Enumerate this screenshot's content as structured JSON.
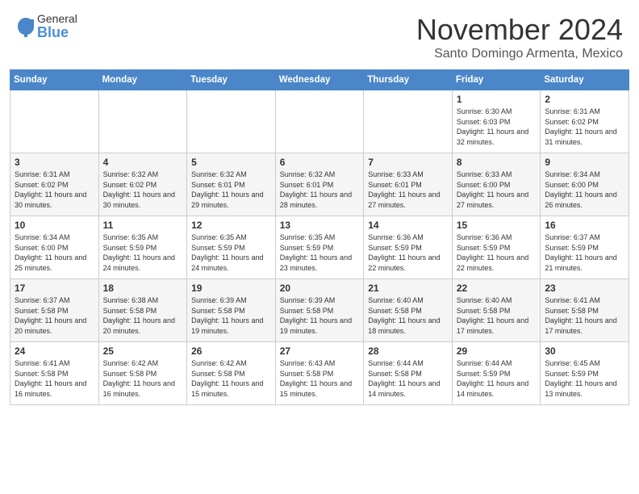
{
  "logo": {
    "general": "General",
    "blue": "Blue"
  },
  "title": {
    "month": "November 2024",
    "location": "Santo Domingo Armenta, Mexico"
  },
  "days_of_week": [
    "Sunday",
    "Monday",
    "Tuesday",
    "Wednesday",
    "Thursday",
    "Friday",
    "Saturday"
  ],
  "weeks": [
    [
      {
        "day": "",
        "info": ""
      },
      {
        "day": "",
        "info": ""
      },
      {
        "day": "",
        "info": ""
      },
      {
        "day": "",
        "info": ""
      },
      {
        "day": "",
        "info": ""
      },
      {
        "day": "1",
        "info": "Sunrise: 6:30 AM\nSunset: 6:03 PM\nDaylight: 11 hours\nand 32 minutes."
      },
      {
        "day": "2",
        "info": "Sunrise: 6:31 AM\nSunset: 6:02 PM\nDaylight: 11 hours\nand 31 minutes."
      }
    ],
    [
      {
        "day": "3",
        "info": "Sunrise: 6:31 AM\nSunset: 6:02 PM\nDaylight: 11 hours\nand 30 minutes."
      },
      {
        "day": "4",
        "info": "Sunrise: 6:32 AM\nSunset: 6:02 PM\nDaylight: 11 hours\nand 30 minutes."
      },
      {
        "day": "5",
        "info": "Sunrise: 6:32 AM\nSunset: 6:01 PM\nDaylight: 11 hours\nand 29 minutes."
      },
      {
        "day": "6",
        "info": "Sunrise: 6:32 AM\nSunset: 6:01 PM\nDaylight: 11 hours\nand 28 minutes."
      },
      {
        "day": "7",
        "info": "Sunrise: 6:33 AM\nSunset: 6:01 PM\nDaylight: 11 hours\nand 27 minutes."
      },
      {
        "day": "8",
        "info": "Sunrise: 6:33 AM\nSunset: 6:00 PM\nDaylight: 11 hours\nand 27 minutes."
      },
      {
        "day": "9",
        "info": "Sunrise: 6:34 AM\nSunset: 6:00 PM\nDaylight: 11 hours\nand 26 minutes."
      }
    ],
    [
      {
        "day": "10",
        "info": "Sunrise: 6:34 AM\nSunset: 6:00 PM\nDaylight: 11 hours\nand 25 minutes."
      },
      {
        "day": "11",
        "info": "Sunrise: 6:35 AM\nSunset: 5:59 PM\nDaylight: 11 hours\nand 24 minutes."
      },
      {
        "day": "12",
        "info": "Sunrise: 6:35 AM\nSunset: 5:59 PM\nDaylight: 11 hours\nand 24 minutes."
      },
      {
        "day": "13",
        "info": "Sunrise: 6:35 AM\nSunset: 5:59 PM\nDaylight: 11 hours\nand 23 minutes."
      },
      {
        "day": "14",
        "info": "Sunrise: 6:36 AM\nSunset: 5:59 PM\nDaylight: 11 hours\nand 22 minutes."
      },
      {
        "day": "15",
        "info": "Sunrise: 6:36 AM\nSunset: 5:59 PM\nDaylight: 11 hours\nand 22 minutes."
      },
      {
        "day": "16",
        "info": "Sunrise: 6:37 AM\nSunset: 5:59 PM\nDaylight: 11 hours\nand 21 minutes."
      }
    ],
    [
      {
        "day": "17",
        "info": "Sunrise: 6:37 AM\nSunset: 5:58 PM\nDaylight: 11 hours\nand 20 minutes."
      },
      {
        "day": "18",
        "info": "Sunrise: 6:38 AM\nSunset: 5:58 PM\nDaylight: 11 hours\nand 20 minutes."
      },
      {
        "day": "19",
        "info": "Sunrise: 6:39 AM\nSunset: 5:58 PM\nDaylight: 11 hours\nand 19 minutes."
      },
      {
        "day": "20",
        "info": "Sunrise: 6:39 AM\nSunset: 5:58 PM\nDaylight: 11 hours\nand 19 minutes."
      },
      {
        "day": "21",
        "info": "Sunrise: 6:40 AM\nSunset: 5:58 PM\nDaylight: 11 hours\nand 18 minutes."
      },
      {
        "day": "22",
        "info": "Sunrise: 6:40 AM\nSunset: 5:58 PM\nDaylight: 11 hours\nand 17 minutes."
      },
      {
        "day": "23",
        "info": "Sunrise: 6:41 AM\nSunset: 5:58 PM\nDaylight: 11 hours\nand 17 minutes."
      }
    ],
    [
      {
        "day": "24",
        "info": "Sunrise: 6:41 AM\nSunset: 5:58 PM\nDaylight: 11 hours\nand 16 minutes."
      },
      {
        "day": "25",
        "info": "Sunrise: 6:42 AM\nSunset: 5:58 PM\nDaylight: 11 hours\nand 16 minutes."
      },
      {
        "day": "26",
        "info": "Sunrise: 6:42 AM\nSunset: 5:58 PM\nDaylight: 11 hours\nand 15 minutes."
      },
      {
        "day": "27",
        "info": "Sunrise: 6:43 AM\nSunset: 5:58 PM\nDaylight: 11 hours\nand 15 minutes."
      },
      {
        "day": "28",
        "info": "Sunrise: 6:44 AM\nSunset: 5:58 PM\nDaylight: 11 hours\nand 14 minutes."
      },
      {
        "day": "29",
        "info": "Sunrise: 6:44 AM\nSunset: 5:59 PM\nDaylight: 11 hours\nand 14 minutes."
      },
      {
        "day": "30",
        "info": "Sunrise: 6:45 AM\nSunset: 5:59 PM\nDaylight: 11 hours\nand 13 minutes."
      }
    ]
  ]
}
